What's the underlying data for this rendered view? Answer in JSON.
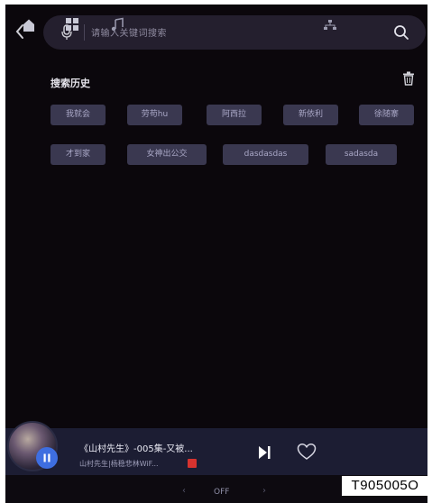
{
  "search": {
    "placeholder": "请输入关键词搜索"
  },
  "history": {
    "title": "搜索历史",
    "chips": [
      "我就会",
      "劳苟hu",
      "阿西拉",
      "新依利",
      "徐随寨",
      "才到家",
      "女神出公交",
      "dasdasdas",
      "sadasda"
    ]
  },
  "player": {
    "title": "《山村先生》-005集-又被...",
    "subtitle": "山村先生|杨稳悲林WiF...",
    "state": "playing"
  },
  "bottom_nav": {
    "off_label": "OFF",
    "left_chevron": "‹",
    "right_chevron": "›"
  },
  "watermark": "T905005O",
  "colors": {
    "background": "#0b070c",
    "search_bar": "#241f2e",
    "chip": "#3a3850",
    "player_bar": "#1c1d33",
    "accent": "#3e6ee0"
  }
}
